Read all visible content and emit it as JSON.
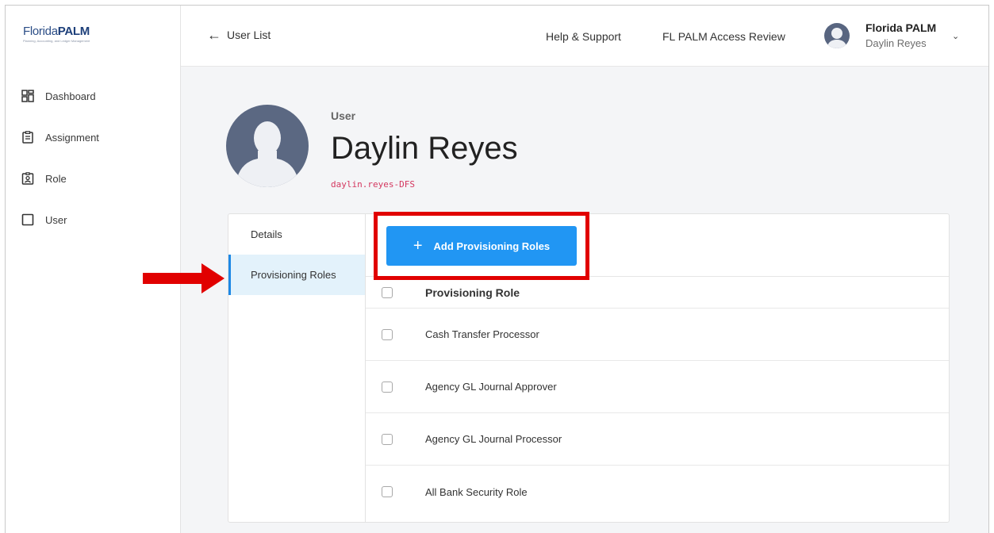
{
  "app": {
    "logo_light": "Florida",
    "logo_bold": "PALM",
    "logo_tagline": "Planning, Accounting, and Ledger Management"
  },
  "sidebar": {
    "items": [
      {
        "label": "Dashboard",
        "icon": "dashboard-icon"
      },
      {
        "label": "Assignment",
        "icon": "clipboard-icon"
      },
      {
        "label": "Role",
        "icon": "badge-icon"
      },
      {
        "label": "User",
        "icon": "square-icon"
      }
    ]
  },
  "topbar": {
    "back_label": "User List",
    "back_icon": "arrow-left-icon",
    "links": [
      "Help & Support",
      "FL PALM Access Review"
    ],
    "org_name": "Florida PALM",
    "user_name": "Daylin Reyes"
  },
  "profile": {
    "kind": "User",
    "name": "Daylin Reyes",
    "user_id": "daylin.reyes-DFS"
  },
  "tabs": [
    {
      "label": "Details",
      "active": false
    },
    {
      "label": "Provisioning Roles",
      "active": true
    }
  ],
  "provisioning": {
    "add_button_label": "Add Provisioning Roles",
    "column_header": "Provisioning Role",
    "roles": [
      "Cash Transfer Processor",
      "Agency GL Journal Approver",
      "Agency GL Journal Processor",
      "All Bank Security Role"
    ]
  },
  "colors": {
    "accent": "#2196f3",
    "annotation_red": "#e10000",
    "active_tab_bg": "#e3f2fb",
    "user_id_text": "#d4375f"
  }
}
